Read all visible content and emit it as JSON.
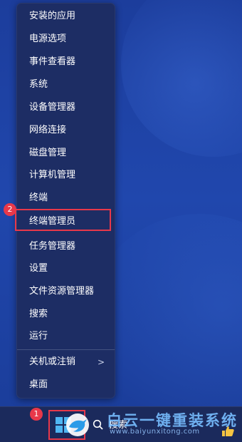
{
  "context_menu": {
    "items": [
      {
        "label": "安装的应用"
      },
      {
        "label": "电源选项"
      },
      {
        "label": "事件查看器"
      },
      {
        "label": "系统"
      },
      {
        "label": "设备管理器"
      },
      {
        "label": "网络连接"
      },
      {
        "label": "磁盘管理"
      },
      {
        "label": "计算机管理"
      },
      {
        "label": "终端"
      },
      {
        "label": "终端管理员",
        "highlighted": true
      },
      {
        "label": "任务管理器"
      },
      {
        "label": "设置"
      },
      {
        "label": "文件资源管理器"
      },
      {
        "label": "搜索"
      },
      {
        "label": "运行"
      },
      {
        "label": "关机或注销",
        "has_submenu": true
      },
      {
        "label": "桌面"
      }
    ],
    "submenu_arrow": ">"
  },
  "annotations": {
    "badge_start": "1",
    "badge_item": "2",
    "color": "#e8384a"
  },
  "taskbar": {
    "search_label": "搜索",
    "start_icon": "windows-icon",
    "search_icon": "search-icon"
  },
  "watermark": {
    "text": "白云一键重装系统",
    "url": "www.baiyunxitong.com"
  }
}
